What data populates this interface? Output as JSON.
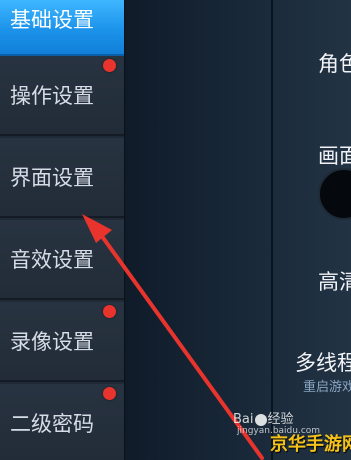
{
  "sidebar": {
    "items": [
      {
        "label": "基础设置",
        "active": true,
        "badge": false
      },
      {
        "label": "操作设置",
        "active": false,
        "badge": true
      },
      {
        "label": "界面设置",
        "active": false,
        "badge": false
      },
      {
        "label": "音效设置",
        "active": false,
        "badge": false
      },
      {
        "label": "录像设置",
        "active": false,
        "badge": true
      },
      {
        "label": "二级密码",
        "active": false,
        "badge": true
      }
    ]
  },
  "panel": {
    "options": [
      {
        "label": "角色"
      },
      {
        "label": "画面"
      },
      {
        "label": "高清"
      },
      {
        "label": "多线程",
        "sub": "重启游戏"
      }
    ]
  },
  "watermark": {
    "baidu_prefix": "Bai",
    "baidu_suffix": "经验",
    "url": "jingyan.baidu.com",
    "site": "京华手游网"
  },
  "colors": {
    "active_tab": "#1c93ea",
    "badge": "#e8342c",
    "arrow": "#e8342c",
    "site_watermark": "#f4c21b"
  }
}
